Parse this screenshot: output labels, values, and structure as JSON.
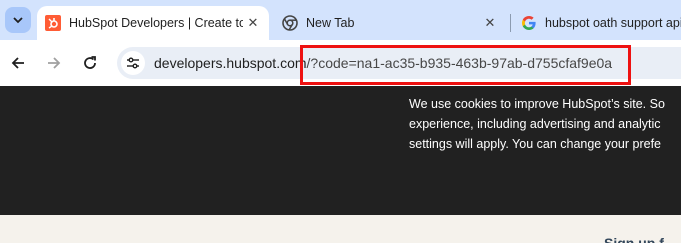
{
  "tabs": [
    {
      "title": "HubSpot Developers | Create to",
      "favicon": "hubspot-icon",
      "active": true
    },
    {
      "title": "New Tab",
      "favicon": "chrome-icon",
      "active": false
    },
    {
      "title": "hubspot oath support api",
      "favicon": "google-icon",
      "active": false
    }
  ],
  "toolbar": {
    "url_host": "developers.hubspot.com",
    "url_path": "/?code=na1-ac35-b935-463b-97ab-d755cfaf9e0a"
  },
  "cookie_banner": {
    "line1": "We use cookies to improve HubSpot’s site. So",
    "line2": "experience, including advertising and analytic",
    "line3": "settings will apply. You can change your prefe"
  },
  "page": {
    "partial_heading": "Sign up f"
  },
  "colors": {
    "tabstrip": "#d3e3fd",
    "banner": "#212121",
    "highlight": "#ee1111",
    "hubspot_orange": "#ff5c35"
  }
}
